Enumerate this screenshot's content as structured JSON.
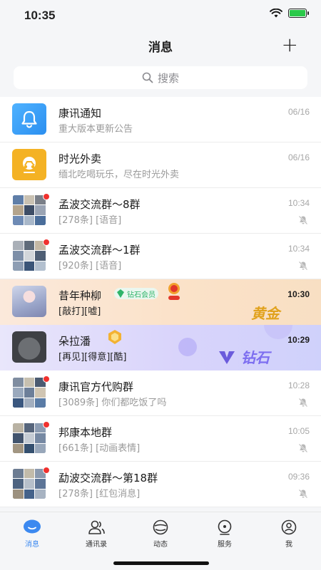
{
  "status": {
    "time": "10:35"
  },
  "nav": {
    "title": "消息",
    "add": "+"
  },
  "search": {
    "placeholder": "搜索"
  },
  "colors": {
    "accent": "#3c89f0",
    "unread": "#f0312e",
    "gold_text": "#e1a21d",
    "diamond_text": "#7d6ef0"
  },
  "conversations": [
    {
      "name": "康讯通知",
      "preview": "重大版本更新公告",
      "time": "06/16",
      "avatar": "bell-icon",
      "muted": false,
      "unread": false
    },
    {
      "name": "时光外卖",
      "preview": "缅北吃喝玩乐，尽在时光外卖",
      "time": "06/16",
      "avatar": "delivery-scooter-icon",
      "muted": false,
      "unread": false
    },
    {
      "name": "孟波交流群～8群",
      "preview": "[278条] [语音]",
      "time": "10:34",
      "avatar": "group-avatar",
      "muted": true,
      "unread": true
    },
    {
      "name": "孟波交流群～1群",
      "preview": "[920条] [语音]",
      "time": "10:34",
      "avatar": "group-avatar",
      "muted": true,
      "unread": true
    },
    {
      "name": "昔年种柳",
      "preview": "[敲打][嘘]",
      "time": "10:30",
      "avatar": "user-avatar",
      "muted": false,
      "unread": false,
      "tier": "黄金",
      "badge_text": "钻石会员"
    },
    {
      "name": "朵拉潘",
      "preview": "[再见][得意][酷]",
      "time": "10:29",
      "avatar": "cat-avatar",
      "muted": false,
      "unread": false,
      "tier": "钻石"
    },
    {
      "name": "康讯官方代购群",
      "preview": "[3089条] 你们都吃饭了吗",
      "time": "10:28",
      "avatar": "group-avatar",
      "muted": true,
      "unread": true
    },
    {
      "name": "邦康本地群",
      "preview": "[661条] [动画表情]",
      "time": "10:05",
      "avatar": "group-avatar",
      "muted": true,
      "unread": true
    },
    {
      "name": "勐波交流群～第18群",
      "preview": "[278条] [红包消息]",
      "time": "09:36",
      "avatar": "group-avatar",
      "muted": true,
      "unread": true
    }
  ],
  "tabs": [
    {
      "label": "消息",
      "icon": "chat-bubble-icon",
      "active": true
    },
    {
      "label": "通讯录",
      "icon": "contacts-icon",
      "active": false
    },
    {
      "label": "动态",
      "icon": "moments-icon",
      "active": false
    },
    {
      "label": "服务",
      "icon": "service-icon",
      "active": false
    },
    {
      "label": "我",
      "icon": "profile-icon",
      "active": false
    }
  ]
}
